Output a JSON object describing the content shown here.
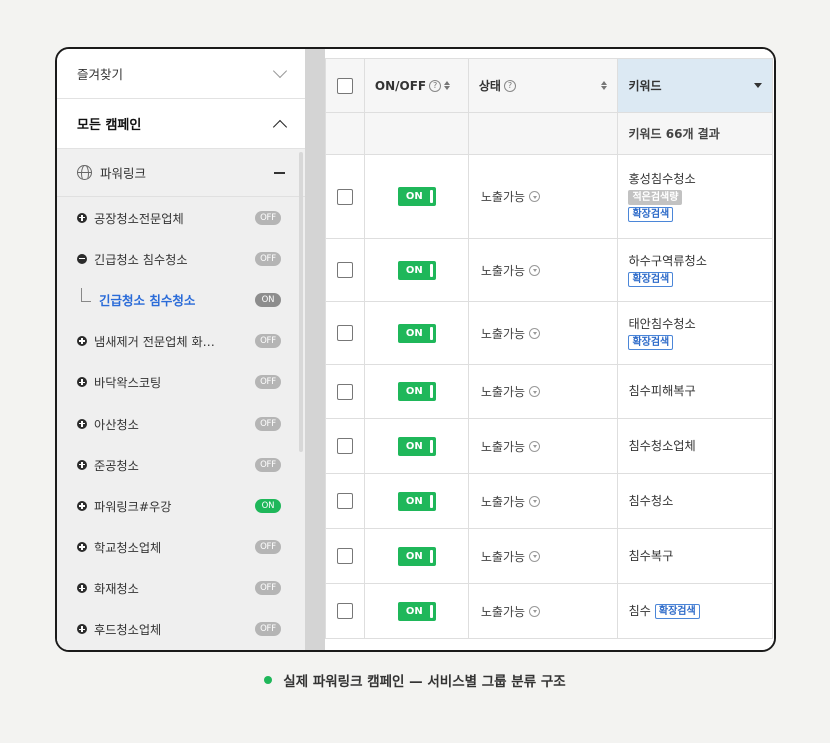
{
  "sidebar": {
    "favorites": "즐겨찾기",
    "all_campaigns": "모든 캠페인",
    "powerlink": "파워링크",
    "items": [
      {
        "label": "공장청소전문업체",
        "state": "OFF",
        "type": "plus"
      },
      {
        "label": "긴급청소 침수청소",
        "state": "OFF",
        "type": "minus"
      },
      {
        "label": "긴급청소 침수청소",
        "state": "ON",
        "type": "sub"
      },
      {
        "label": "냄새제거 전문업체 화…",
        "state": "OFF",
        "type": "plus"
      },
      {
        "label": "바닥왁스코팅",
        "state": "OFF",
        "type": "plus"
      },
      {
        "label": "아산청소",
        "state": "OFF",
        "type": "plus"
      },
      {
        "label": "준공청소",
        "state": "OFF",
        "type": "plus"
      },
      {
        "label": "파워링크#우강",
        "state": "ON",
        "type": "plus"
      },
      {
        "label": "학교청소업체",
        "state": "OFF",
        "type": "plus"
      },
      {
        "label": "화재청소",
        "state": "OFF",
        "type": "plus"
      },
      {
        "label": "후드청소업체",
        "state": "OFF",
        "type": "plus"
      }
    ]
  },
  "table": {
    "headers": {
      "onoff": "ON/OFF",
      "status": "상태",
      "keyword": "키워드"
    },
    "summary": "키워드 66개 결과",
    "rows": [
      {
        "toggle": "ON",
        "status": "노출가능",
        "keyword": "홍성침수청소",
        "tags": [
          {
            "text": "적은검색량",
            "style": "gray"
          },
          {
            "text": "확장검색",
            "style": "blue"
          }
        ],
        "inline": false
      },
      {
        "toggle": "ON",
        "status": "노출가능",
        "keyword": "하수구역류청소",
        "tags": [
          {
            "text": "확장검색",
            "style": "blue"
          }
        ],
        "inline": false
      },
      {
        "toggle": "ON",
        "status": "노출가능",
        "keyword": "태안침수청소",
        "tags": [
          {
            "text": "확장검색",
            "style": "blue"
          }
        ],
        "inline": false
      },
      {
        "toggle": "ON",
        "status": "노출가능",
        "keyword": "침수피해복구",
        "tags": [],
        "inline": false
      },
      {
        "toggle": "ON",
        "status": "노출가능",
        "keyword": "침수청소업체",
        "tags": [],
        "inline": false
      },
      {
        "toggle": "ON",
        "status": "노출가능",
        "keyword": "침수청소",
        "tags": [],
        "inline": false
      },
      {
        "toggle": "ON",
        "status": "노출가능",
        "keyword": "침수복구",
        "tags": [],
        "inline": false
      },
      {
        "toggle": "ON",
        "status": "노출가능",
        "keyword": "침수",
        "tags": [
          {
            "text": "확장검색",
            "style": "blue"
          }
        ],
        "inline": true
      }
    ]
  },
  "caption": "실제 파워링크 캠페인 — 서비스별 그룹 분류 구조",
  "colors": {
    "accent_green": "#1fb75a",
    "link_blue": "#2a6bd8",
    "keyword_header": "#dce9f3"
  }
}
